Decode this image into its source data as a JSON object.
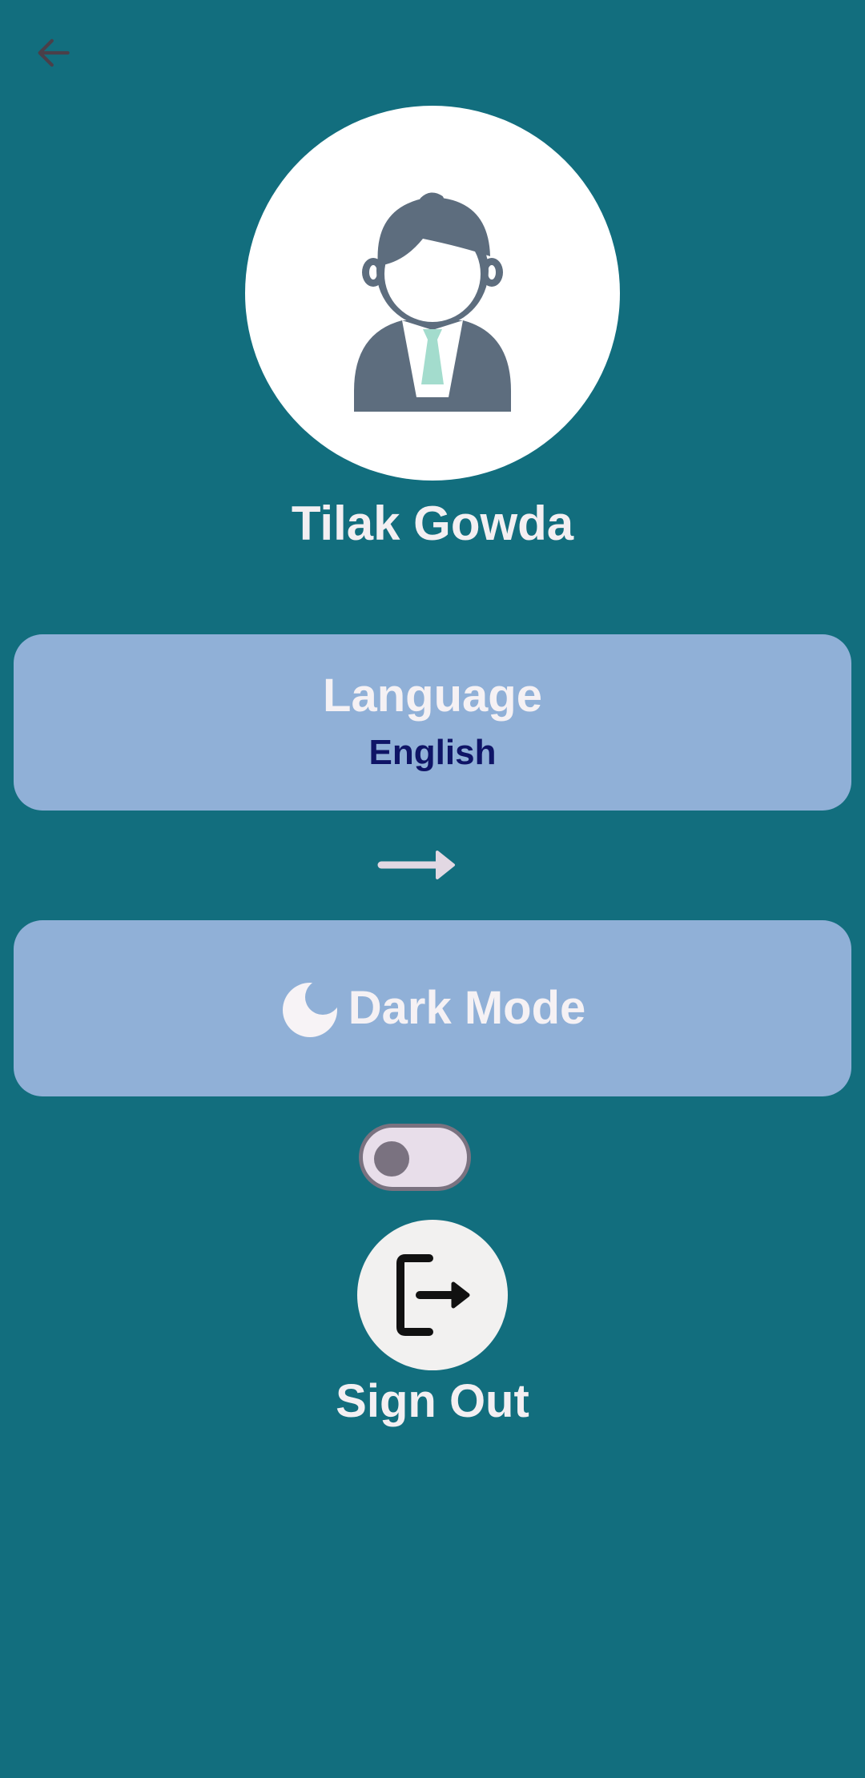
{
  "header": {
    "back_icon": "arrow-left-icon"
  },
  "profile": {
    "avatar_icon": "user-avatar-icon",
    "name": "Tilak Gowda"
  },
  "language_card": {
    "title": "Language",
    "value": "English"
  },
  "language_arrow_icon": "arrow-right-icon",
  "dark_mode_card": {
    "icon": "moon-icon",
    "label": "Dark Mode"
  },
  "dark_mode_toggle": {
    "enabled": false
  },
  "sign_out": {
    "icon": "logout-icon",
    "label": "Sign Out"
  },
  "colors": {
    "background": "#126E7E",
    "card": "#90B0D7",
    "language_value": "#0F1466",
    "text_light": "#F3EFF2"
  }
}
